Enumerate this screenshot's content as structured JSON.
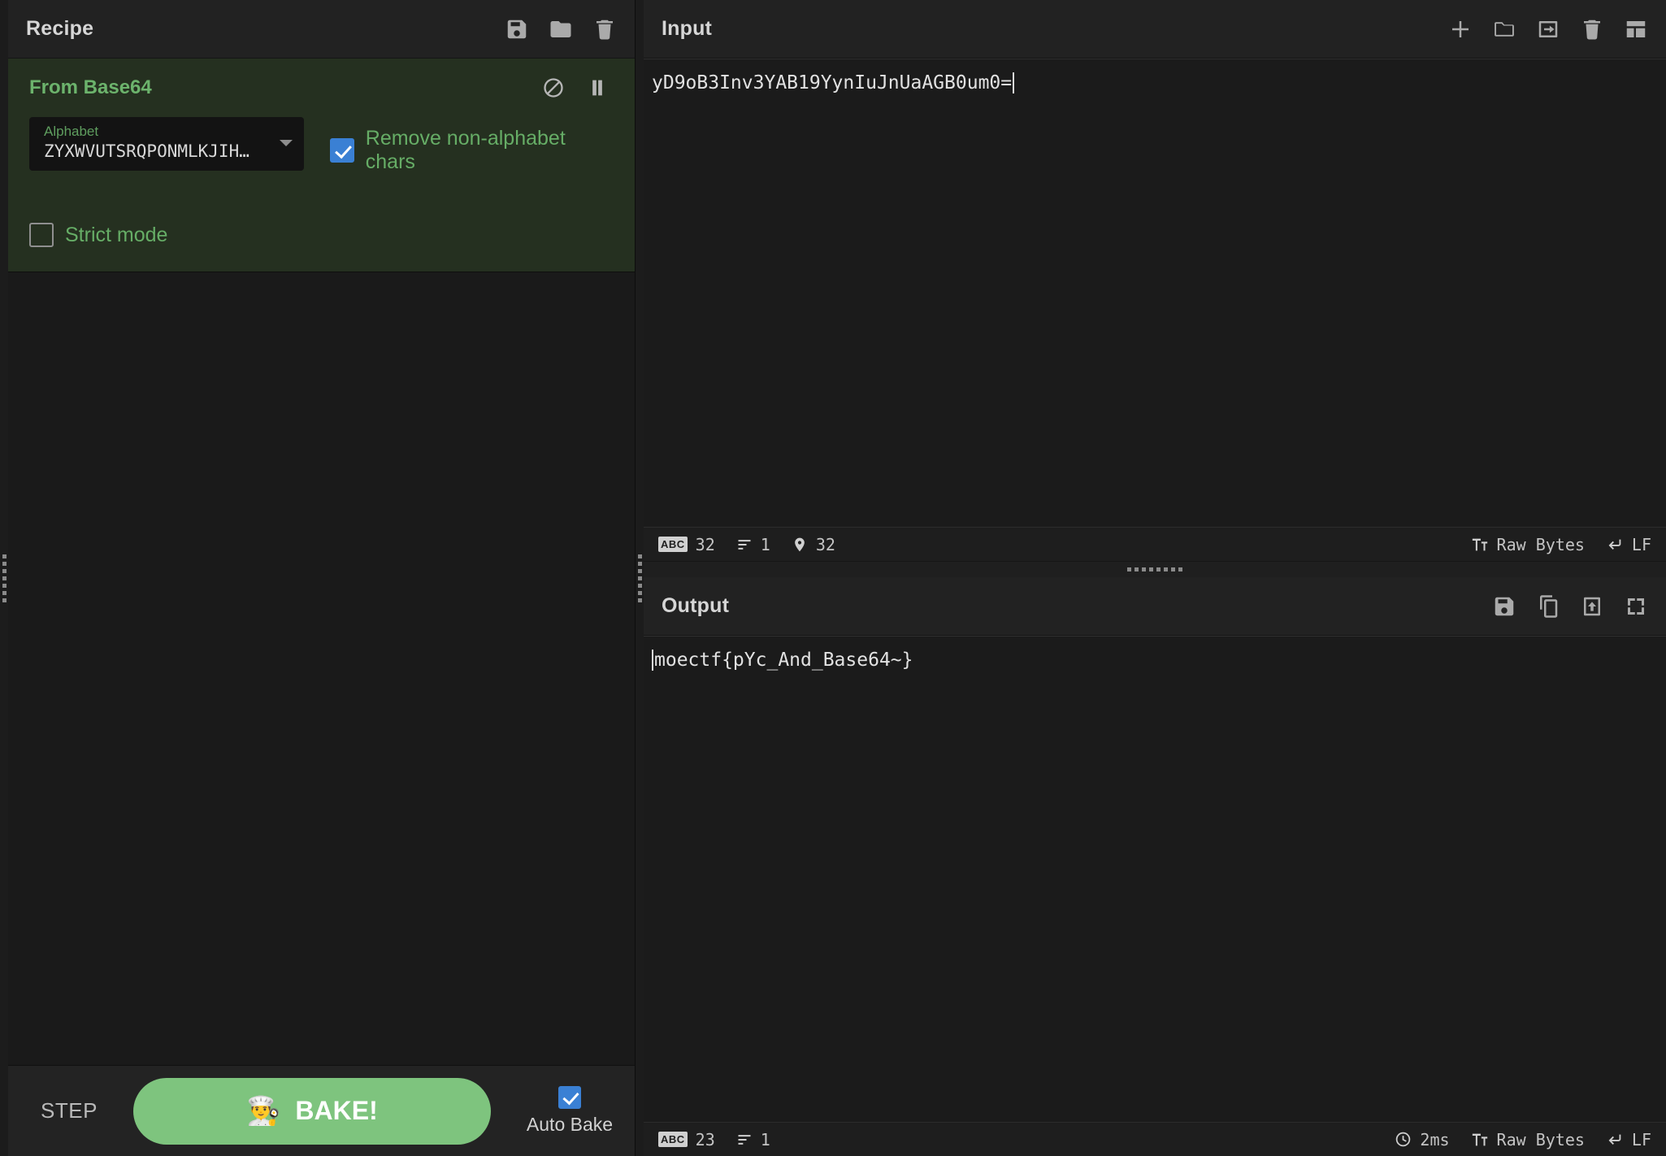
{
  "recipe": {
    "title": "Recipe",
    "header_icons": [
      {
        "name": "save-recipe-icon",
        "glyph": "floppy"
      },
      {
        "name": "load-recipe-icon",
        "glyph": "folder"
      },
      {
        "name": "clear-recipe-icon",
        "glyph": "trash"
      }
    ],
    "operations": [
      {
        "name": "From Base64",
        "controls": [
          {
            "name": "disable-operation-icon",
            "glyph": "ban"
          },
          {
            "name": "set-breakpoint-icon",
            "glyph": "pause"
          }
        ],
        "args": {
          "alphabet_label": "Alphabet",
          "alphabet_value": "ZYXWVUTSRQPONMLKJIH…",
          "remove_non_alphabet_label": "Remove non-alphabet chars",
          "remove_non_alphabet_checked": true,
          "strict_mode_label": "Strict mode",
          "strict_mode_checked": false
        }
      }
    ]
  },
  "controls": {
    "step_label": "STEP",
    "bake_label": "BAKE!",
    "bake_emoji": "👨‍🍳",
    "auto_bake_label": "Auto Bake",
    "auto_bake_checked": true
  },
  "input": {
    "title": "Input",
    "header_icons": [
      {
        "name": "add-input-tab-icon",
        "glyph": "plus"
      },
      {
        "name": "open-folder-as-input-icon",
        "glyph": "folder"
      },
      {
        "name": "open-file-as-input-icon",
        "glyph": "file-in"
      },
      {
        "name": "clear-input-icon",
        "glyph": "trash"
      },
      {
        "name": "reset-pane-layout-icon",
        "glyph": "layout"
      }
    ],
    "text": "yD9oB3Inv3YAB19YynIuJnUaAGB0um0=",
    "status": {
      "chars_label": "32",
      "lines_label": "1",
      "position_label": "32",
      "encoding_label": "Raw Bytes",
      "line_ending_label": "LF"
    }
  },
  "output": {
    "title": "Output",
    "header_icons": [
      {
        "name": "save-output-icon",
        "glyph": "floppy"
      },
      {
        "name": "copy-output-icon",
        "glyph": "copy"
      },
      {
        "name": "replace-input-with-output-icon",
        "glyph": "bake-up"
      },
      {
        "name": "maximise-output-icon",
        "glyph": "expand"
      }
    ],
    "text": "moectf{pYc_And_Base64~}",
    "status": {
      "chars_label": "23",
      "lines_label": "1",
      "time_label": "2ms",
      "encoding_label": "Raw Bytes",
      "line_ending_label": "LF"
    }
  },
  "colors": {
    "accent_green": "#7ec47e",
    "operation_bg": "#253020",
    "operation_title": "#6cb36c",
    "checkbox_blue": "#3a80d4",
    "pane_bg": "#1b1b1b",
    "header_bg": "#222222"
  }
}
